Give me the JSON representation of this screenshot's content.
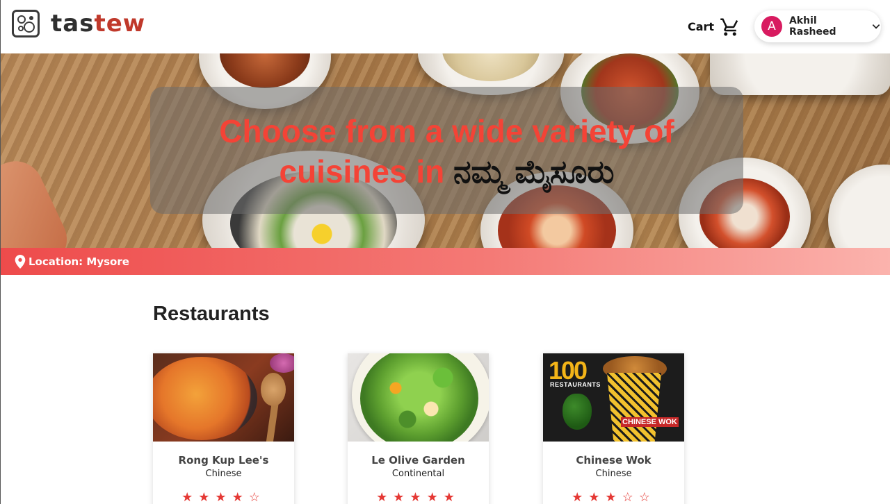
{
  "header": {
    "logo_text_a": "tas",
    "logo_text_b": "tew",
    "cart_label": "Cart",
    "user": {
      "avatar_letter": "A",
      "name": "Akhil Rasheed"
    }
  },
  "hero": {
    "title_line1": "Choose from a wide variety of",
    "title_line2_prefix": "cuisines in",
    "title_line2_kannada": "ನಮ್ಮ ಮೈಸೂರು"
  },
  "location": {
    "label": "Location: Mysore"
  },
  "restaurants": {
    "heading": "Restaurants",
    "items": [
      {
        "name": "Rong Kup Lee's",
        "cuisine": "Chinese",
        "rating": 4
      },
      {
        "name": "Le Olive Garden",
        "cuisine": "Continental",
        "rating": 5
      },
      {
        "name": "Chinese Wok",
        "cuisine": "Chinese",
        "rating": 3,
        "image_badge": "100",
        "image_badge_sub": "RESTAURANTS",
        "image_cup_label": "CHINESE WOK"
      }
    ]
  },
  "colors": {
    "accent": "#f44336",
    "brand_dark": "#2f2f2f",
    "brand_red": "#c0392b",
    "avatar": "#d81b60"
  },
  "icons": [
    "logo-icon",
    "cart-icon",
    "chevron-down-icon",
    "location-pin-icon",
    "star-icon"
  ]
}
